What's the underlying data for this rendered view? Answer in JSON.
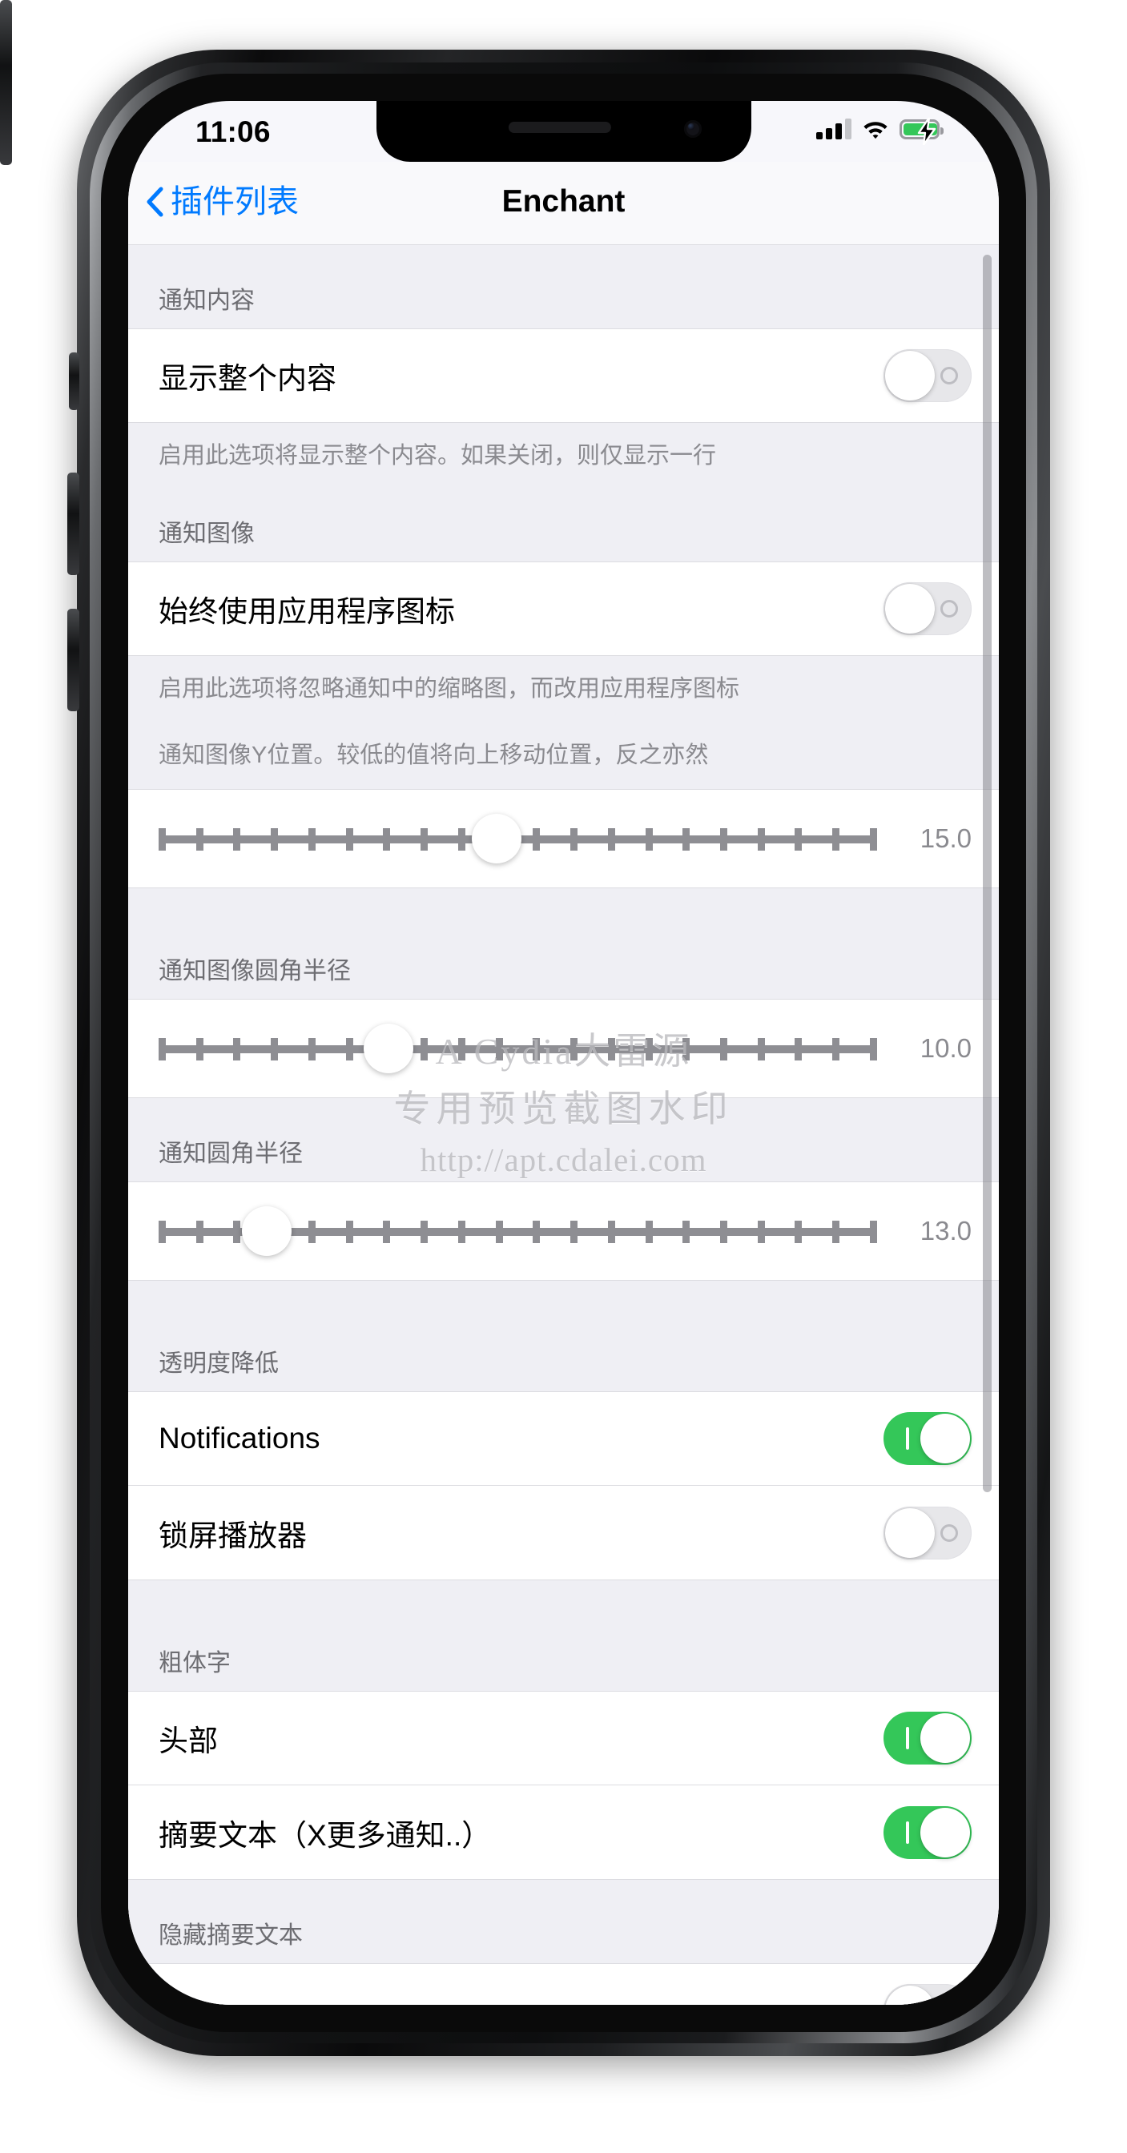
{
  "status_bar": {
    "time": "11:06",
    "signal_icon": "cellular-signal-icon",
    "signal_bars_filled": 3,
    "signal_bars_total": 4,
    "wifi_icon": "wifi-icon",
    "battery_icon": "battery-charging-icon",
    "battery_color": "#34c759"
  },
  "nav": {
    "back_icon": "chevron-left-icon",
    "back_label": "插件列表",
    "title": "Enchant"
  },
  "sections": [
    {
      "header": "通知内容",
      "rows": [
        {
          "type": "switch",
          "label": "显示整个内容",
          "value": "off"
        }
      ],
      "footer": "启用此选项将显示整个内容。如果关闭，则仅显示一行"
    },
    {
      "header": "通知图像",
      "rows": [
        {
          "type": "switch",
          "label": "始终使用应用程序图标",
          "value": "off"
        }
      ],
      "footer": "启用此选项将忽略通知中的缩略图，而改用应用程序图标",
      "footer2": "通知图像Y位置。较低的值将向上移动位置，反之亦然"
    },
    {
      "header": "",
      "rows": [
        {
          "type": "slider",
          "value_label": "15.0",
          "percent": 47
        }
      ]
    },
    {
      "header": "通知图像圆角半径",
      "rows": [
        {
          "type": "slider",
          "value_label": "10.0",
          "percent": 32
        }
      ]
    },
    {
      "header": "通知圆角半径",
      "rows": [
        {
          "type": "slider",
          "value_label": "13.0",
          "percent": 15
        }
      ]
    },
    {
      "header": "透明度降低",
      "rows": [
        {
          "type": "switch",
          "label": "Notifications",
          "value": "on"
        },
        {
          "type": "switch",
          "label": "锁屏播放器",
          "value": "off"
        }
      ]
    },
    {
      "header": "粗体字",
      "rows": [
        {
          "type": "switch",
          "label": "头部",
          "value": "on"
        },
        {
          "type": "switch",
          "label": "摘要文本（X更多通知..）",
          "value": "on"
        }
      ]
    },
    {
      "header": "隐藏摘要文本",
      "rows": [
        {
          "type": "switch",
          "label": "",
          "value": "off"
        }
      ]
    }
  ],
  "watermark": {
    "line1": "A Cydia大雷源",
    "line2": "专用预览截图水印",
    "line3": "http://apt.cdalei.com"
  },
  "colors": {
    "accent": "#007aff",
    "switch_on": "#34c759",
    "group_bg": "#efeff4",
    "cell_bg": "#ffffff",
    "secondary_text": "#6d6d72"
  }
}
